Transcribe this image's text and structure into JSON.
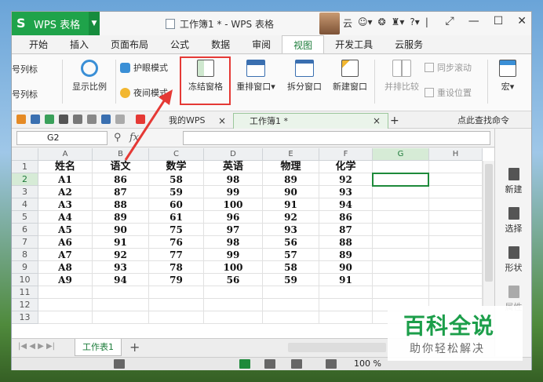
{
  "app": {
    "name": "WPS 表格",
    "doc_title": "工作簿1 * - WPS 表格",
    "user_initial": "云"
  },
  "window_controls": {
    "min": "—",
    "max": "☐",
    "close": "✕"
  },
  "menu_tabs": [
    "开始",
    "插入",
    "页面布局",
    "公式",
    "数据",
    "审阅",
    "视图",
    "开发工具",
    "云服务"
  ],
  "active_tab": "视图",
  "ribbon": {
    "row_label_1": "号列标",
    "row_label_2": "号列标",
    "show_ratio": "显示比例",
    "eye_mode": "护眼模式",
    "night_mode": "夜间模式",
    "freeze": "冻结窗格",
    "rearrange": "重排窗口",
    "split": "拆分窗口",
    "new_window": "新建窗口",
    "side_by_side": "并排比较",
    "sync_scroll": "同步滚动",
    "reset_pos": "重设位置",
    "macro": "宏"
  },
  "doc_tabs": {
    "my_wps": "我的WPS",
    "workbook": "工作簿1 *",
    "find_cmd": "点此查找命令"
  },
  "formula_bar": {
    "cell_ref": "G2",
    "fx": "fx"
  },
  "columns": [
    "A",
    "B",
    "C",
    "D",
    "E",
    "F",
    "G",
    "H"
  ],
  "rows": [
    "1",
    "2",
    "3",
    "4",
    "5",
    "6",
    "7",
    "8",
    "9",
    "10",
    "11",
    "12",
    "13"
  ],
  "table": {
    "header": [
      "姓名",
      "语文",
      "数学",
      "英语",
      "物理",
      "化学"
    ],
    "data": [
      [
        "A1",
        "86",
        "58",
        "98",
        "89",
        "92"
      ],
      [
        "A2",
        "87",
        "59",
        "99",
        "90",
        "93"
      ],
      [
        "A3",
        "88",
        "60",
        "100",
        "91",
        "94"
      ],
      [
        "A4",
        "89",
        "61",
        "96",
        "92",
        "86"
      ],
      [
        "A5",
        "90",
        "75",
        "97",
        "93",
        "87"
      ],
      [
        "A6",
        "91",
        "76",
        "98",
        "56",
        "88"
      ],
      [
        "A7",
        "92",
        "77",
        "99",
        "57",
        "89"
      ],
      [
        "A8",
        "93",
        "78",
        "100",
        "58",
        "90"
      ],
      [
        "A9",
        "94",
        "79",
        "56",
        "59",
        "91"
      ]
    ]
  },
  "right_panel": {
    "new": "新建",
    "select": "选择",
    "shape": "形状",
    "property": "属性"
  },
  "sheet": {
    "name": "工作表1",
    "add": "+"
  },
  "status": {
    "zoom": "100 %"
  },
  "watermark": {
    "title": "百科全说",
    "subtitle": "助你轻松解决"
  }
}
